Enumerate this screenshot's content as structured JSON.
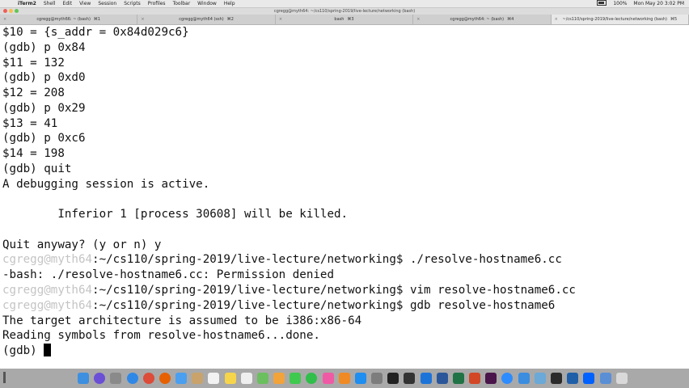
{
  "menubar": {
    "apple": "",
    "app_name": "iTerm2",
    "menus": [
      "Shell",
      "Edit",
      "View",
      "Session",
      "Scripts",
      "Profiles",
      "Toolbar",
      "Window",
      "Help"
    ],
    "battery": "100%",
    "clock": "Mon May 20  3:02 PM"
  },
  "window": {
    "title": "cgregg@myth64: ~/cs110/spring-2019/live-lecture/networking (bash)"
  },
  "tabs": [
    {
      "label": "cgregg@myth66: ~ (bash)",
      "shortcut": "⌘1"
    },
    {
      "label": "cgregg@myth64 (ssh)",
      "shortcut": "⌘2"
    },
    {
      "label": "bash",
      "shortcut": "⌘3"
    },
    {
      "label": "cgregg@myth64: ~ (bash)",
      "shortcut": "⌘4"
    },
    {
      "label": "~/cs110/spring-2019/live-lecture/networking (bash)",
      "shortcut": "⌘5"
    }
  ],
  "terminal": {
    "lines": [
      {
        "text": "$10 = {s_addr = 0x84d029c6}"
      },
      {
        "text": "(gdb) p 0x84"
      },
      {
        "text": "$11 = 132"
      },
      {
        "text": "(gdb) p 0xd0"
      },
      {
        "text": "$12 = 208"
      },
      {
        "text": "(gdb) p 0x29"
      },
      {
        "text": "$13 = 41"
      },
      {
        "text": "(gdb) p 0xc6"
      },
      {
        "text": "$14 = 198"
      },
      {
        "text": "(gdb) quit"
      },
      {
        "text": "A debugging session is active."
      },
      {
        "text": ""
      },
      {
        "text": "        Inferior 1 [process 30608] will be killed."
      },
      {
        "text": ""
      },
      {
        "text": "Quit anyway? (y or n) y"
      },
      {
        "user": "cgregg@myth64",
        "path": ":~/cs110/spring-2019/live-lecture/networking$ ",
        "cmd": "./resolve-hostname6.cc"
      },
      {
        "text": "-bash: ./resolve-hostname6.cc: Permission denied"
      },
      {
        "user": "cgregg@myth64",
        "path": ":~/cs110/spring-2019/live-lecture/networking$ ",
        "cmd": "vim resolve-hostname6.cc"
      },
      {
        "user": "cgregg@myth64",
        "path": ":~/cs110/spring-2019/live-lecture/networking$ ",
        "cmd": "gdb resolve-hostname6"
      },
      {
        "text": "The target architecture is assumed to be i386:x86-64"
      },
      {
        "text": "Reading symbols from resolve-hostname6...done."
      },
      {
        "text": "(gdb) ",
        "cursor": true
      }
    ]
  },
  "dock": {
    "icons": [
      {
        "name": "finder-icon",
        "color": "#3d8fe0"
      },
      {
        "name": "siri-icon",
        "color": "#6b4fd6"
      },
      {
        "name": "launchpad-icon",
        "color": "#8a8a8a"
      },
      {
        "name": "safari-icon",
        "color": "#2f88e6"
      },
      {
        "name": "chrome-icon",
        "color": "#dd4b39"
      },
      {
        "name": "firefox-icon",
        "color": "#e66000"
      },
      {
        "name": "mail-icon",
        "color": "#4a9ff0"
      },
      {
        "name": "contacts-icon",
        "color": "#c9a36b"
      },
      {
        "name": "calendar-icon",
        "color": "#f2f2f2"
      },
      {
        "name": "notes-icon",
        "color": "#f7d54a"
      },
      {
        "name": "reminders-icon",
        "color": "#efefef"
      },
      {
        "name": "maps-icon",
        "color": "#6cbf5f"
      },
      {
        "name": "photos-icon",
        "color": "#f2a33a"
      },
      {
        "name": "messages-icon",
        "color": "#40c94f"
      },
      {
        "name": "facetime-icon",
        "color": "#2fbf4a"
      },
      {
        "name": "itunes-icon",
        "color": "#f05aa5"
      },
      {
        "name": "ibooks-icon",
        "color": "#f08a24"
      },
      {
        "name": "app-store-icon",
        "color": "#1e8ef0"
      },
      {
        "name": "system-preferences-icon",
        "color": "#7d7d7d"
      },
      {
        "name": "terminal-icon",
        "color": "#222222"
      },
      {
        "name": "iterm-icon",
        "color": "#333333"
      },
      {
        "name": "xcode-icon",
        "color": "#1d74d8"
      },
      {
        "name": "word-icon",
        "color": "#2b579a"
      },
      {
        "name": "excel-icon",
        "color": "#217346"
      },
      {
        "name": "powerpoint-icon",
        "color": "#d24726"
      },
      {
        "name": "slack-icon",
        "color": "#4a154b"
      },
      {
        "name": "zoom-icon",
        "color": "#2d8cff"
      },
      {
        "name": "keynote-icon",
        "color": "#3b8de0"
      },
      {
        "name": "preview-icon",
        "color": "#6aa9d8"
      },
      {
        "name": "activity-monitor-icon",
        "color": "#2b2b2b"
      },
      {
        "name": "quicktime-icon",
        "color": "#1f5fa8"
      },
      {
        "name": "dropbox-icon",
        "color": "#0061fe"
      },
      {
        "name": "downloads-icon",
        "color": "#5a8fd6"
      },
      {
        "name": "trash-icon",
        "color": "#d9d9d9"
      }
    ]
  }
}
